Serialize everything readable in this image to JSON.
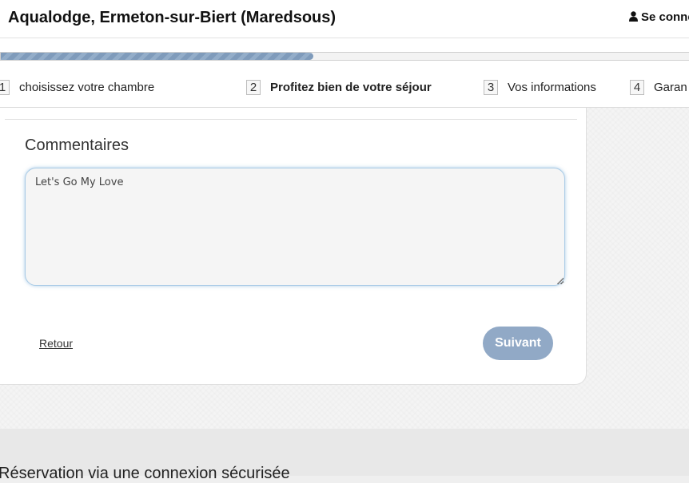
{
  "header": {
    "hotel_title": "Aqualodge, Ermeton-sur-Biert (Maredsous)",
    "login_label": "Se conne",
    "login_icon": "user-icon"
  },
  "progress": {
    "fraction_complete": 0.45
  },
  "steps": [
    {
      "number": "1",
      "label": "choisissez votre chambre",
      "active": false
    },
    {
      "number": "2",
      "label": "Profitez bien de votre séjour",
      "active": true
    },
    {
      "number": "3",
      "label": "Vos informations",
      "active": false
    },
    {
      "number": "4",
      "label": "Garan",
      "active": false
    }
  ],
  "comments": {
    "title": "Commentaires",
    "value": "Let's Go My Love"
  },
  "actions": {
    "back_label": "Retour",
    "next_label": "Suivant"
  },
  "footer": {
    "secure_text": "Réservation via une connexion sécurisée"
  },
  "colors": {
    "accent": "#91a9c6",
    "progress": "#7f9bbb"
  }
}
